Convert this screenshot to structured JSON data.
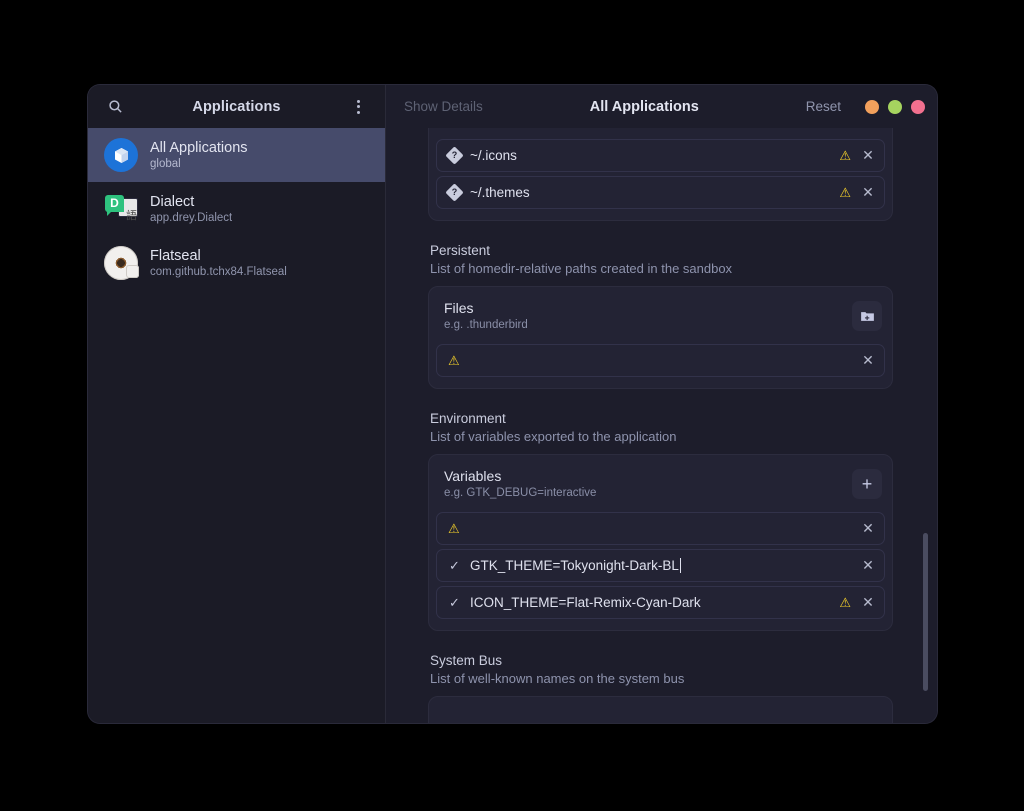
{
  "window": {
    "controls": [
      {
        "name": "minimize",
        "color": "#f2a05c"
      },
      {
        "name": "maximize",
        "color": "#a6d45f"
      },
      {
        "name": "close",
        "color": "#f2708f"
      }
    ]
  },
  "sidebar": {
    "title": "Applications",
    "search_icon": "search-icon",
    "menu_icon": "menu-dots-icon",
    "items": [
      {
        "name": "All Applications",
        "id": "global",
        "icon": "all-applications-icon",
        "selected": true
      },
      {
        "name": "Dialect",
        "id": "app.drey.Dialect",
        "icon": "dialect-icon",
        "selected": false
      },
      {
        "name": "Flatseal",
        "id": "com.github.tchx84.Flatseal",
        "icon": "flatseal-icon",
        "selected": false
      }
    ]
  },
  "main": {
    "show_details": "Show Details",
    "title": "All Applications",
    "reset": "Reset",
    "top_card": {
      "rows": [
        {
          "text": "~/.icons",
          "warn": true,
          "close": true
        },
        {
          "text": "~/.themes",
          "warn": true,
          "close": true
        }
      ]
    },
    "sections": [
      {
        "title": "Persistent",
        "subtitle": "List of homedir-relative paths created in the sandbox",
        "card_label": "Files",
        "card_example": "e.g. .thunderbird",
        "add_icon": "add-folder-icon",
        "rows": [
          {
            "text": "",
            "warn": true,
            "close": true,
            "check": false
          }
        ]
      },
      {
        "title": "Environment",
        "subtitle": "List of variables exported to the application",
        "card_label": "Variables",
        "card_example": "e.g. GTK_DEBUG=interactive",
        "add_icon": "plus-icon",
        "rows": [
          {
            "text": "",
            "warn": true,
            "close": true,
            "check": false
          },
          {
            "text": "GTK_THEME=Tokyonight-Dark-BL",
            "warn": false,
            "close": true,
            "check": true,
            "cursor": true
          },
          {
            "text": "ICON_THEME=Flat-Remix-Cyan-Dark",
            "warn": true,
            "close": true,
            "check": true
          }
        ]
      },
      {
        "title": "System Bus",
        "subtitle": "List of well-known names on the system bus",
        "card_label": "",
        "card_example": "",
        "rows": []
      }
    ]
  }
}
